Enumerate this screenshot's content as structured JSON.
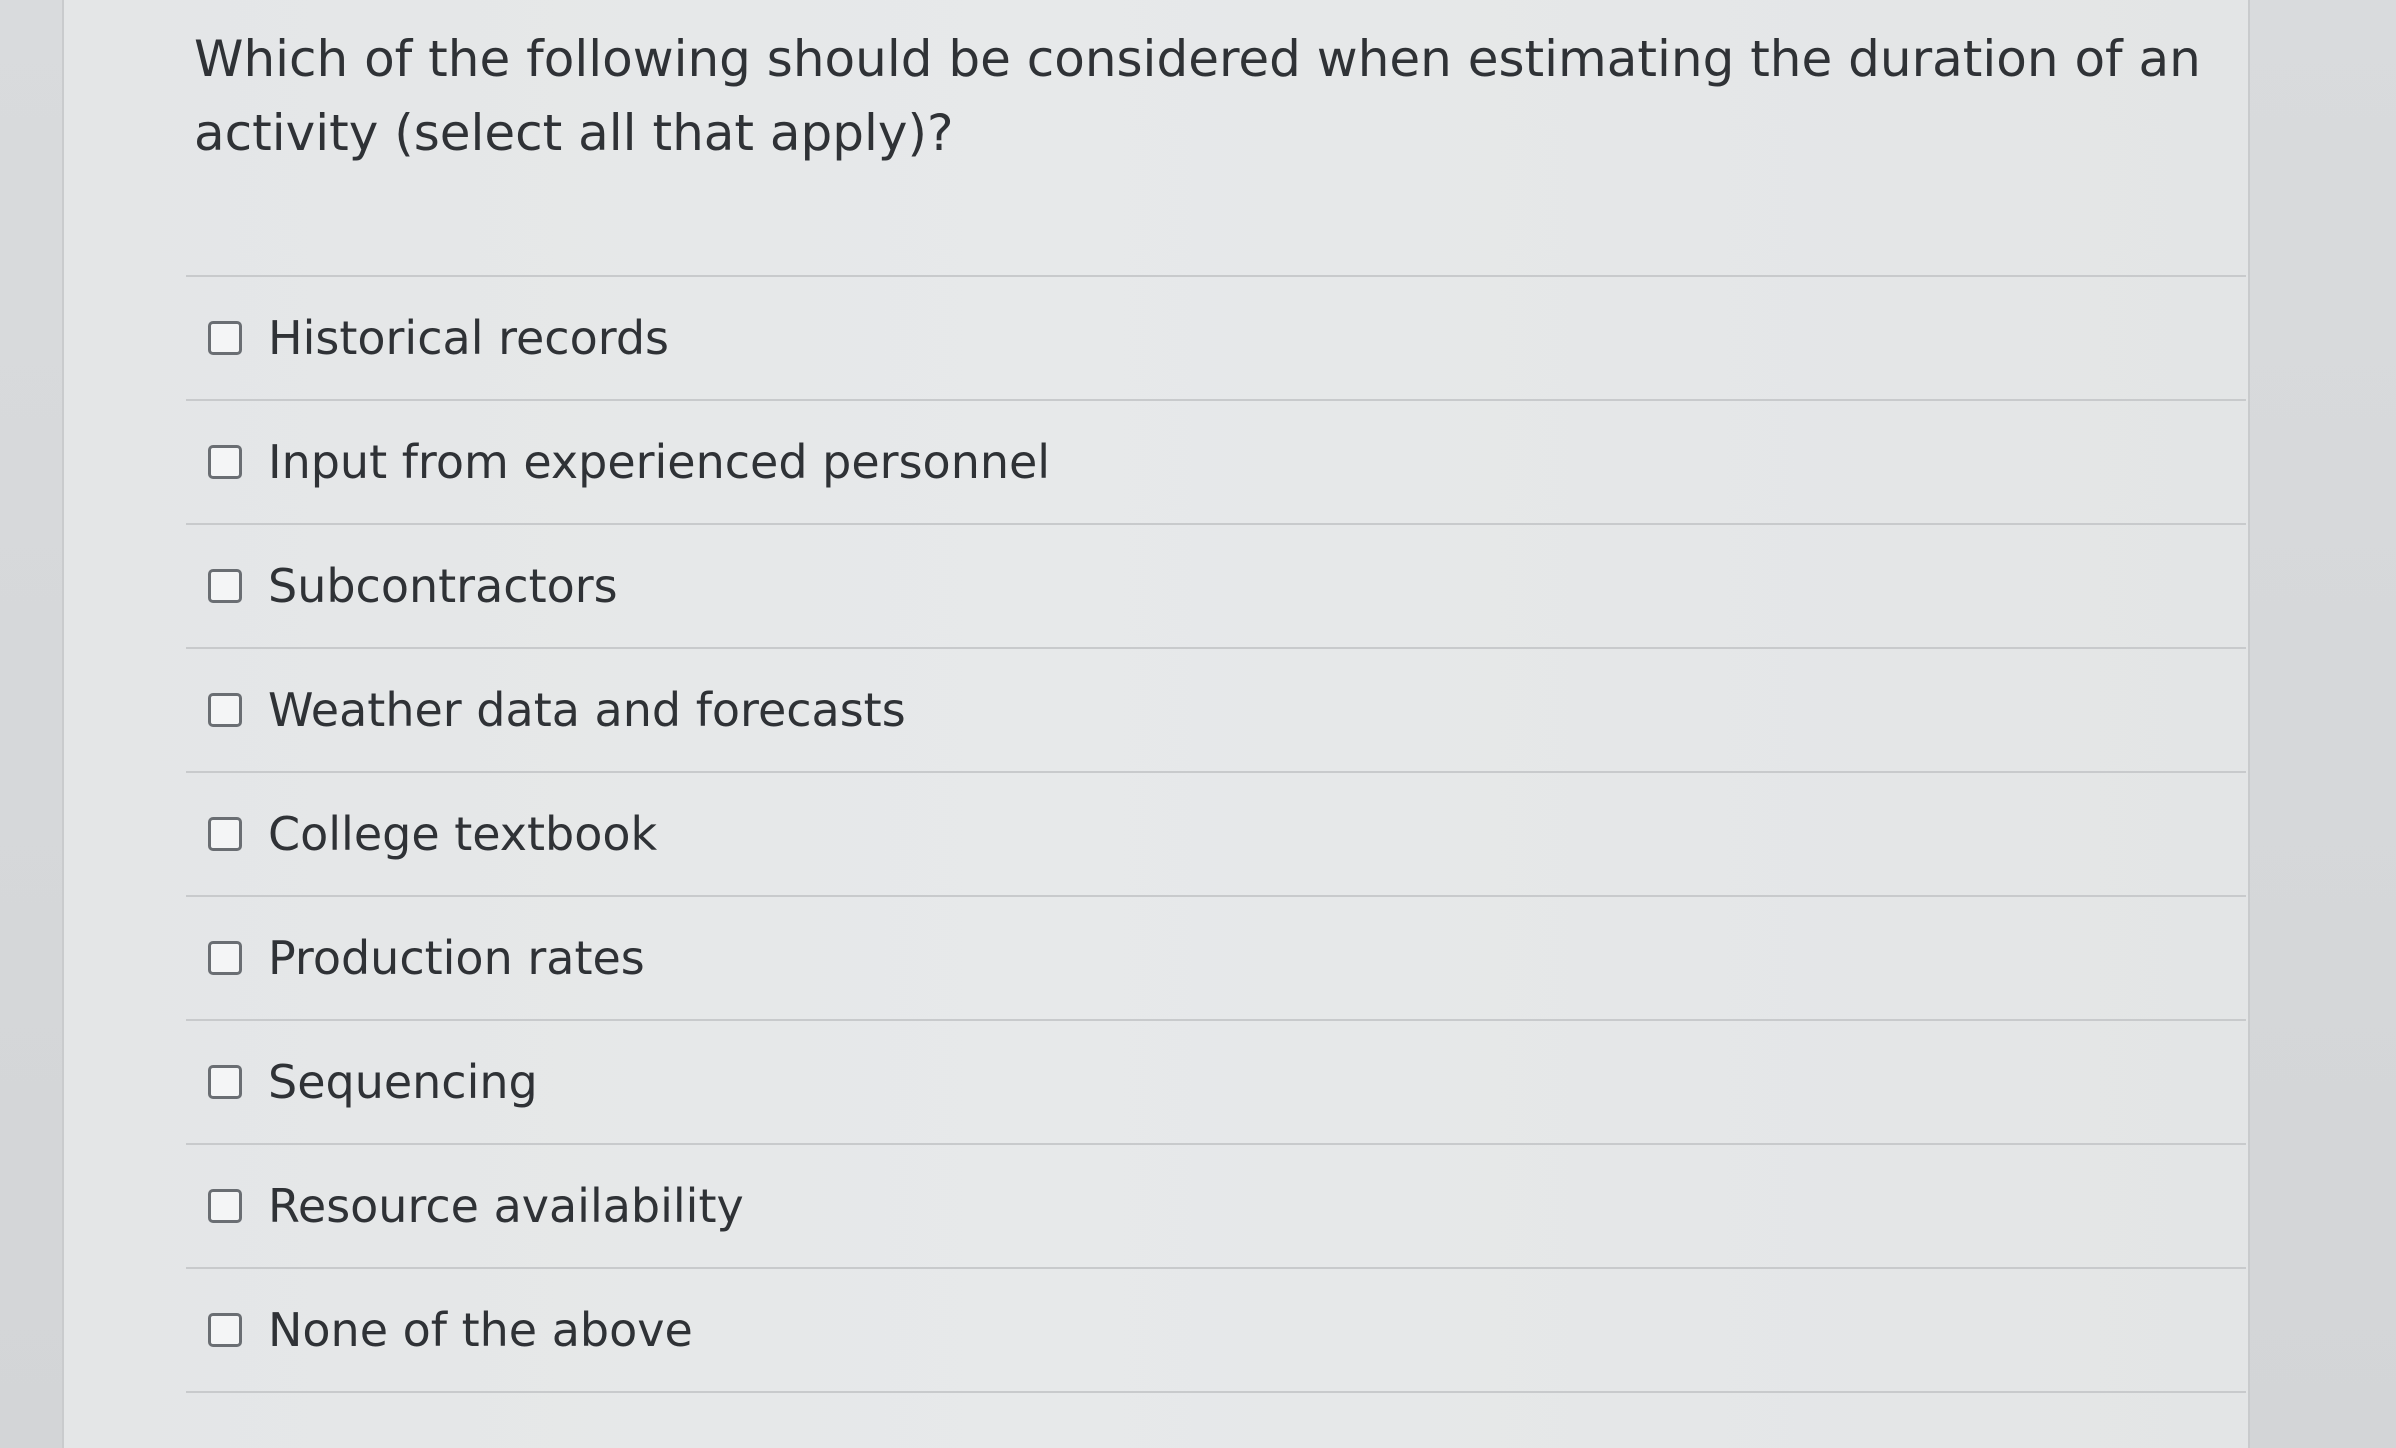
{
  "question": {
    "text": "Which of the following should be considered when estimating the duration of an activity (select all that apply)?"
  },
  "options": [
    {
      "label": "Historical records",
      "checked": false
    },
    {
      "label": "Input from experienced personnel",
      "checked": false
    },
    {
      "label": "Subcontractors",
      "checked": false
    },
    {
      "label": "Weather data and forecasts",
      "checked": false
    },
    {
      "label": "College textbook",
      "checked": false
    },
    {
      "label": "Production rates",
      "checked": false
    },
    {
      "label": "Sequencing",
      "checked": false
    },
    {
      "label": "Resource availability",
      "checked": false
    },
    {
      "label": "None of the above",
      "checked": false
    }
  ],
  "colors": {
    "text": "#2f3236",
    "divider": "#c8cacc",
    "checkbox_border": "#6a6e73",
    "card_background": "#e6e8e9"
  }
}
